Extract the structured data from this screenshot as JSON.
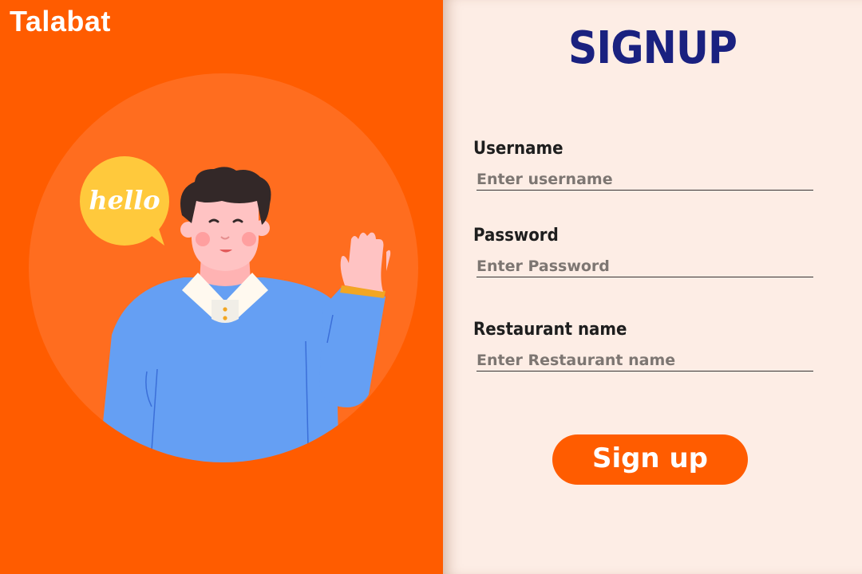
{
  "brand": {
    "name": "Talabat"
  },
  "illustration": {
    "speech_text": "hello"
  },
  "form": {
    "title": "SIGNUP",
    "fields": [
      {
        "label": "Username",
        "placeholder": "Enter username",
        "value": ""
      },
      {
        "label": "Password",
        "placeholder": "Enter Password",
        "value": ""
      },
      {
        "label": "Restaurant name",
        "placeholder": "Enter Restaurant name",
        "value": ""
      }
    ],
    "submit_label": "Sign up"
  },
  "colors": {
    "brand_orange": "#ff5c00",
    "title_navy": "#1a2180",
    "panel_background": "#fdede5",
    "shirt_blue": "#659ff3",
    "bubble_yellow": "#ffc93c"
  }
}
